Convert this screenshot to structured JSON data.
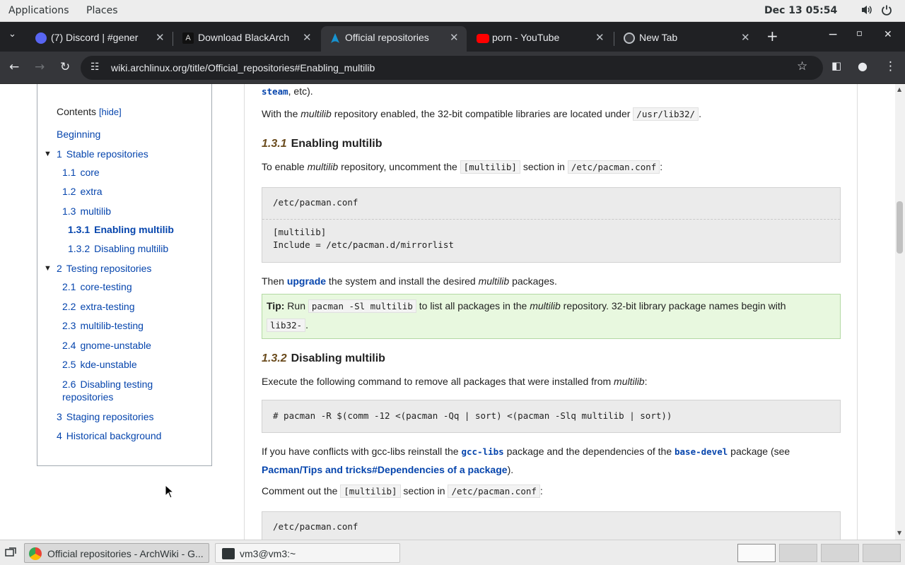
{
  "topbar": {
    "applications": "Applications",
    "places": "Places",
    "clock": "Dec 13  05:54",
    "volume_icon": "volume-icon",
    "power_icon": "power-icon"
  },
  "tabs": [
    {
      "title": "(7) Discord | #gener",
      "icon": "discord-icon",
      "active": false
    },
    {
      "title": "Download BlackArch",
      "icon": "blackarch-icon",
      "active": false
    },
    {
      "title": "Official repositories",
      "icon": "arch-icon",
      "active": true
    },
    {
      "title": "porn - YouTube",
      "icon": "youtube-icon",
      "active": false
    },
    {
      "title": "New Tab",
      "icon": "chrome-icon",
      "active": false
    }
  ],
  "toolbar": {
    "url": "wiki.archlinux.org/title/Official_repositories#Enabling_multilib"
  },
  "toc": {
    "heading": "Contents",
    "hide": "[hide]",
    "items": [
      {
        "num": "",
        "label": "Beginning"
      },
      {
        "num": "1",
        "label": "Stable repositories"
      },
      {
        "num": "1.1",
        "label": "core"
      },
      {
        "num": "1.2",
        "label": "extra"
      },
      {
        "num": "1.3",
        "label": "multilib"
      },
      {
        "num": "1.3.1",
        "label": "Enabling multilib"
      },
      {
        "num": "1.3.2",
        "label": "Disabling multilib"
      },
      {
        "num": "2",
        "label": "Testing repositories"
      },
      {
        "num": "2.1",
        "label": "core-testing"
      },
      {
        "num": "2.2",
        "label": "extra-testing"
      },
      {
        "num": "2.3",
        "label": "multilib-testing"
      },
      {
        "num": "2.4",
        "label": "gnome-unstable"
      },
      {
        "num": "2.5",
        "label": "kde-unstable"
      },
      {
        "num": "2.6",
        "label": "Disabling testing"
      },
      {
        "num": "",
        "label": "repositories"
      },
      {
        "num": "3",
        "label": "Staging repositories"
      },
      {
        "num": "4",
        "label": "Historical background"
      }
    ]
  },
  "content": {
    "steam_pkg": "steam",
    "steam_tail": ", etc).",
    "p1_a": "With the ",
    "p1_em": "multilib",
    "p1_b": " repository enabled, the 32-bit compatible libraries are located under ",
    "p1_code": "/usr/lib32/",
    "p1_c": ".",
    "h_enable_num": "1.3.1",
    "h_enable": "Enabling multilib",
    "p2_a": "To enable ",
    "p2_em": "multilib",
    "p2_b": " repository, uncomment the ",
    "p2_code1": "[multilib]",
    "p2_c": " section in ",
    "p2_code2": "/etc/pacman.conf",
    "p2_d": ":",
    "box1_title": "/etc/pacman.conf",
    "box1_line1": "[multilib]",
    "box1_line2": "Include = /etc/pacman.d/mirrorlist",
    "p3_a": "Then ",
    "p3_link": "upgrade",
    "p3_b": " the system and install the desired ",
    "p3_em": "multilib",
    "p3_c": " packages.",
    "tip_label": "Tip:",
    "tip_a": " Run ",
    "tip_code": "pacman -Sl multilib",
    "tip_b": " to list all packages in the ",
    "tip_em": "multilib",
    "tip_c": " repository. 32-bit library package names begin with",
    "tip_code2": "lib32-",
    "tip_d": ".",
    "h_disable_num": "1.3.2",
    "h_disable": "Disabling multilib",
    "p4_a": "Execute the following command to remove all packages that were installed from ",
    "p4_em": "multilib",
    "p4_b": ":",
    "box2_line": "# pacman -R $(comm -12 <(pacman -Qq | sort) <(pacman -Slq multilib | sort))",
    "p5_a": "If you have conflicts with gcc-libs reinstall the ",
    "p5_pkg1": "gcc-libs",
    "p5_b": " package and the dependencies of the ",
    "p5_pkg2": "base-devel",
    "p5_c": " package (see",
    "p5_link": "Pacman/Tips and tricks#Dependencies of a package",
    "p5_d": ").",
    "p6_a": "Comment out the ",
    "p6_code1": "[multilib]",
    "p6_b": " section in ",
    "p6_code2": "/etc/pacman.conf",
    "p6_c": ":",
    "box3_title": "/etc/pacman.conf"
  },
  "taskbar": {
    "task1": "Official repositories - ArchWiki - G...",
    "task2": "vm3@vm3:~"
  }
}
